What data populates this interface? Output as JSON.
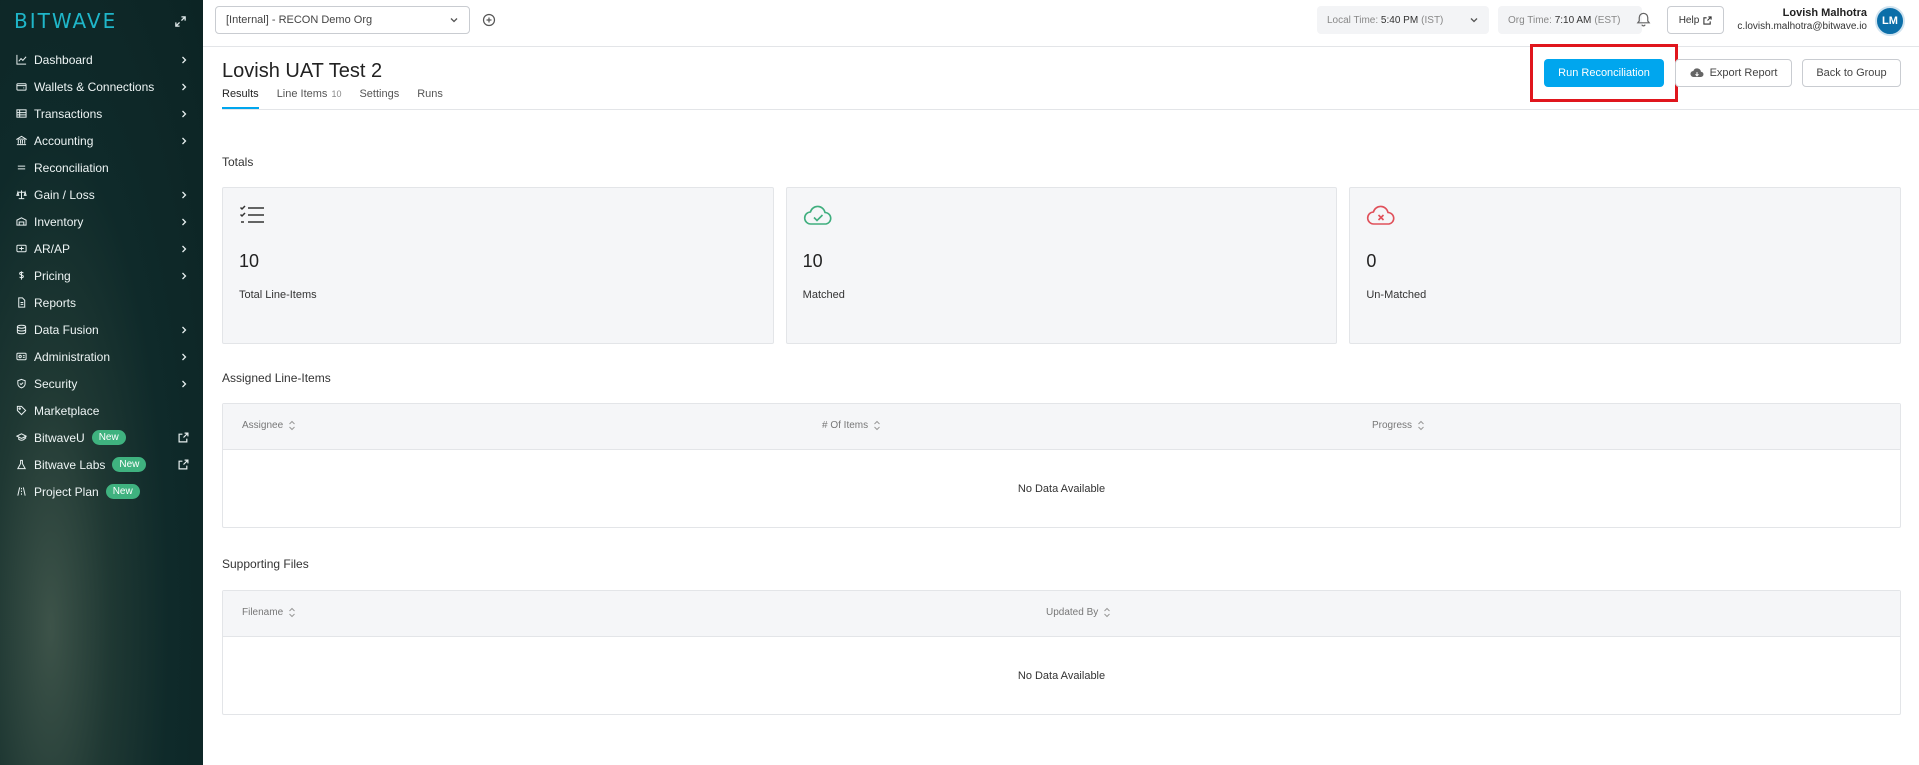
{
  "brand": {
    "logo_text": "BITWAVE",
    "accent": "#1fb6c9"
  },
  "sidebar": {
    "items": [
      {
        "label": "Dashboard",
        "icon": "chart-line-icon",
        "chevron": true
      },
      {
        "label": "Wallets & Connections",
        "icon": "wallet-icon",
        "chevron": true
      },
      {
        "label": "Transactions",
        "icon": "table-icon",
        "chevron": true
      },
      {
        "label": "Accounting",
        "icon": "bank-icon",
        "chevron": true
      },
      {
        "label": "Reconciliation",
        "icon": "equals-icon",
        "chevron": false
      },
      {
        "label": "Gain / Loss",
        "icon": "scale-icon",
        "chevron": true
      },
      {
        "label": "Inventory",
        "icon": "warehouse-icon",
        "chevron": true
      },
      {
        "label": "AR/AP",
        "icon": "invoice-icon",
        "chevron": true
      },
      {
        "label": "Pricing",
        "icon": "dollar-icon",
        "chevron": true
      },
      {
        "label": "Reports",
        "icon": "file-icon",
        "chevron": false
      },
      {
        "label": "Data Fusion",
        "icon": "database-icon",
        "chevron": true
      },
      {
        "label": "Administration",
        "icon": "admin-icon",
        "chevron": true
      },
      {
        "label": "Security",
        "icon": "shield-icon",
        "chevron": true
      },
      {
        "label": "Marketplace",
        "icon": "tag-icon",
        "chevron": false
      },
      {
        "label": "BitwaveU",
        "icon": "graduation-icon",
        "badge": "New",
        "external": true
      },
      {
        "label": "Bitwave Labs",
        "icon": "flask-icon",
        "badge": "New",
        "external": true
      },
      {
        "label": "Project Plan",
        "icon": "road-icon",
        "badge": "New"
      }
    ]
  },
  "topbar": {
    "org_select": "[Internal] - RECON Demo Org",
    "local_time_label": "Local Time:",
    "local_time_value": "5:40 PM",
    "local_time_tz": "(IST)",
    "org_time_label": "Org Time:",
    "org_time_value": "7:10 AM",
    "org_time_tz": "(EST)",
    "help_label": "Help",
    "user_name": "Lovish Malhotra",
    "user_email": "c.lovish.malhotra@bitwave.io",
    "avatar_initials": "LM"
  },
  "page": {
    "title": "Lovish UAT Test 2",
    "run_button": "Run Reconciliation",
    "export_button": "Export Report",
    "back_button": "Back to Group",
    "tabs": [
      {
        "label": "Results",
        "count": ""
      },
      {
        "label": "Line Items",
        "count": "10"
      },
      {
        "label": "Settings",
        "count": ""
      },
      {
        "label": "Runs",
        "count": ""
      }
    ]
  },
  "totals": {
    "title": "Totals",
    "cards": [
      {
        "value": "10",
        "label": "Total Line-Items",
        "icon": "checklist-icon",
        "color": "#333333"
      },
      {
        "value": "10",
        "label": "Matched",
        "icon": "cloud-check-icon",
        "color": "#3fae7e"
      },
      {
        "value": "0",
        "label": "Un-Matched",
        "icon": "cloud-x-icon",
        "color": "#e0505a"
      }
    ]
  },
  "assigned": {
    "title": "Assigned Line-Items",
    "columns": [
      "Assignee",
      "# Of Items",
      "Progress"
    ],
    "empty": "No Data Available"
  },
  "supporting": {
    "title": "Supporting Files",
    "columns": [
      "Filename",
      "Updated By"
    ],
    "empty": "No Data Available"
  }
}
